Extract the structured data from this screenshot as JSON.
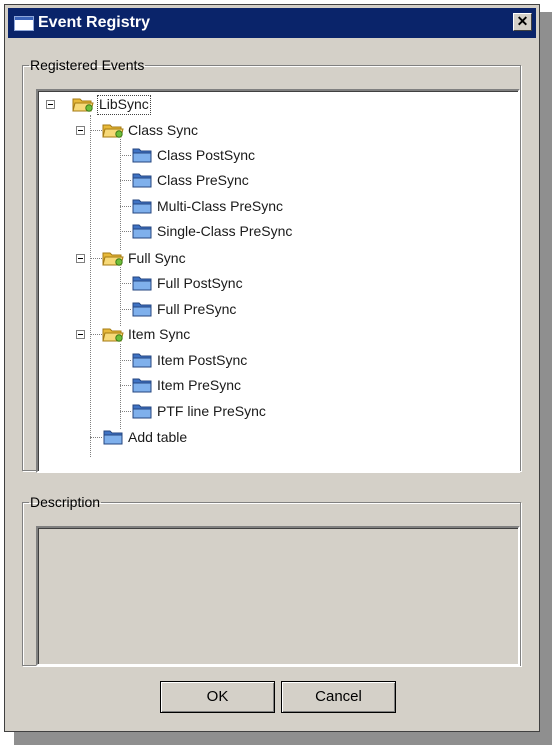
{
  "window": {
    "title": "Event Registry",
    "close_glyph": "✕"
  },
  "registered_events": {
    "legend": "Registered Events",
    "tree": [
      {
        "label": "LibSync",
        "type": "folder",
        "expanded": true,
        "focused": true
      },
      {
        "label": "Class Sync",
        "type": "folder",
        "expanded": true
      },
      {
        "label": "Class PostSync",
        "type": "event"
      },
      {
        "label": "Class PreSync",
        "type": "event"
      },
      {
        "label": "Multi-Class PreSync",
        "type": "event"
      },
      {
        "label": "Single-Class PreSync",
        "type": "event"
      },
      {
        "label": "Full Sync",
        "type": "folder",
        "expanded": true
      },
      {
        "label": "Full PostSync",
        "type": "event"
      },
      {
        "label": "Full PreSync",
        "type": "event"
      },
      {
        "label": "Item Sync",
        "type": "folder",
        "expanded": true
      },
      {
        "label": "Item PostSync",
        "type": "event"
      },
      {
        "label": "Item PreSync",
        "type": "event"
      },
      {
        "label": "PTF line PreSync",
        "type": "event"
      },
      {
        "label": "Add table",
        "type": "event"
      }
    ]
  },
  "description": {
    "legend": "Description",
    "text": ""
  },
  "buttons": {
    "ok": "OK",
    "cancel": "Cancel"
  },
  "icons": {
    "folder": "folder-open-icon",
    "event": "event-folder-icon",
    "title": "window-icon"
  },
  "colors": {
    "titlebar": "#0a246a",
    "dialog_bg": "#d4d0c8",
    "folder_yellow": "#f2c94c",
    "folder_blue": "#5b8fd6"
  }
}
